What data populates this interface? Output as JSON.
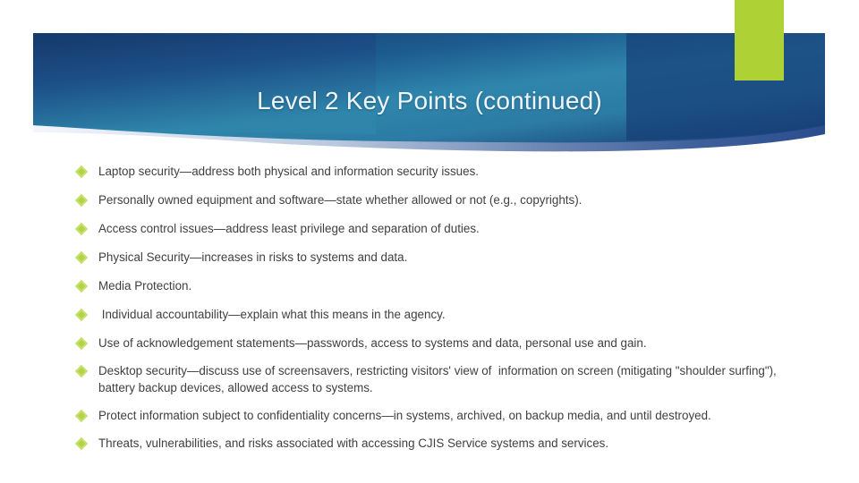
{
  "slide": {
    "title": "Level 2 Key Points (continued)",
    "accent_green": "#aed136",
    "banner_dark_blue": "#1b4178",
    "banner_teal": "#2d81a8",
    "bullet_color": "#b3d44a",
    "text_color": "#3f3f3f",
    "title_color": "#eef6fb"
  },
  "bullets": [
    {
      "text": "Laptop security—address both physical and information security issues."
    },
    {
      "text": "Personally owned equipment and software—state whether allowed or not (e.g., copyrights)."
    },
    {
      "text": "Access control issues—address least privilege and separation of duties."
    },
    {
      "text": "Physical Security—increases in risks to systems and data."
    },
    {
      "text": "Media Protection."
    },
    {
      "text": " Individual accountability—explain what this means in the agency."
    },
    {
      "text": "Use of acknowledgement statements—passwords, access to systems and data, personal use and gain."
    },
    {
      "text": "Desktop security—discuss use of screensavers, restricting visitors' view of  information on screen (mitigating \"shoulder surfing\"), battery backup devices, allowed access to systems."
    },
    {
      "text": "Protect information subject to confidentiality concerns—in systems, archived, on backup media, and until destroyed."
    },
    {
      "text": "Threats, vulnerabilities, and risks associated with accessing CJIS Service systems and services."
    }
  ]
}
